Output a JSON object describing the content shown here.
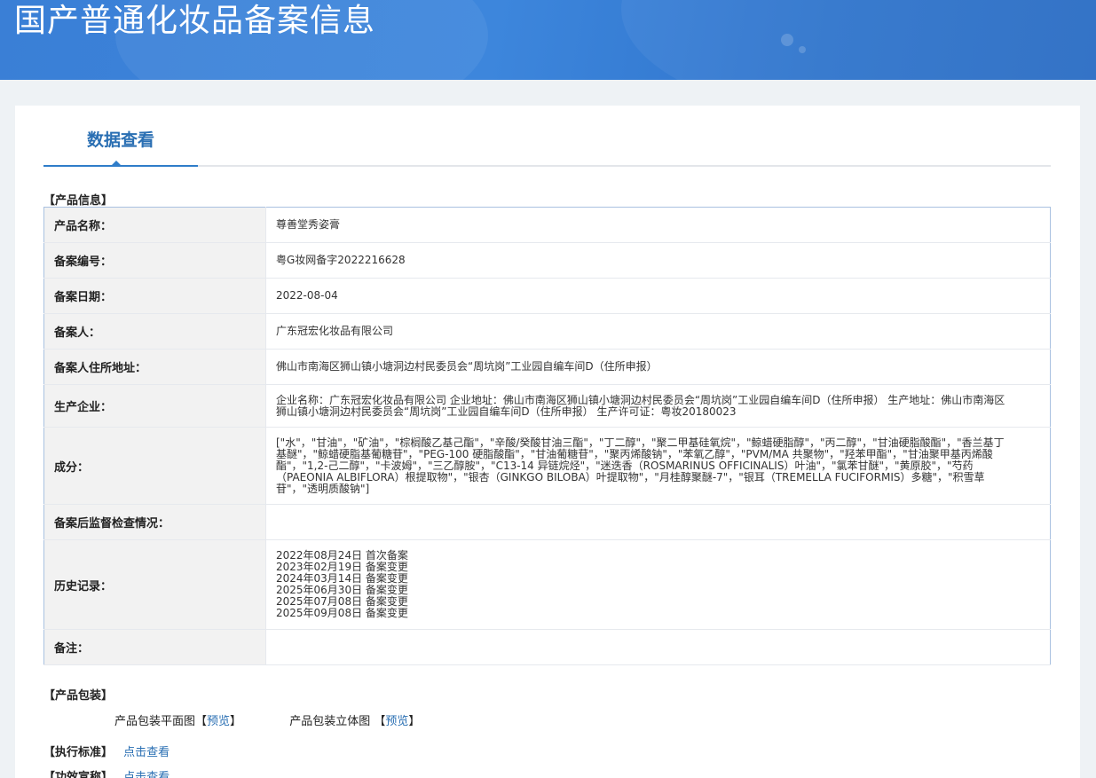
{
  "header": {
    "title": "国产普通化妆品备案信息"
  },
  "tabs": [
    {
      "label": "数据查看"
    }
  ],
  "product_info": {
    "section_title": "【产品信息】",
    "rows": [
      {
        "label": "产品名称：",
        "value": "尊善堂秀姿膏"
      },
      {
        "label": "备案编号：",
        "value": "粤G妆网备字2022216628"
      },
      {
        "label": "备案日期：",
        "value": "2022-08-04"
      },
      {
        "label": "备案人：",
        "value": "广东冠宏化妆品有限公司"
      },
      {
        "label": "备案人住所地址：",
        "value": "佛山市南海区狮山镇小塘洞边村民委员会“周坑岗”工业园自编车间D（住所申报）"
      },
      {
        "label": "生产企业：",
        "value": "企业名称：广东冠宏化妆品有限公司 企业地址：佛山市南海区狮山镇小塘洞边村民委员会“周坑岗”工业园自编车间D（住所申报） 生产地址：佛山市南海区狮山镇小塘洞边村民委员会“周坑岗”工业园自编车间D（住所申报） 生产许可证：粤妆20180023"
      },
      {
        "label": "成分：",
        "value": "[\"水\"，\"甘油\"，\"矿油\"，\"棕榈酸乙基己酯\"，\"辛酸/癸酸甘油三酯\"，\"丁二醇\"，\"聚二甲基硅氧烷\"，\"鲸蜡硬脂醇\"，\"丙二醇\"，\"甘油硬脂酸酯\"，\"香兰基丁基醚\"，\"鲸蜡硬脂基葡糖苷\"，\"PEG-100 硬脂酸酯\"，\"甘油葡糖苷\"，\"聚丙烯酸钠\"，\"苯氧乙醇\"，\"PVM/MA 共聚物\"，\"羟苯甲酯\"，\"甘油聚甲基丙烯酸酯\"，\"1,2-己二醇\"，\"卡波姆\"，\"三乙醇胺\"，\"C13-14 异链烷烃\"，\"迷迭香（ROSMARINUS OFFICINALIS）叶油\"，\"氯苯甘醚\"，\"黄原胶\"，\"芍药（PAEONIA ALBIFLORA）根提取物\"，\"银杏（GINKGO BILOBA）叶提取物\"，\"月桂醇聚醚-7\"，\"银耳（TREMELLA FUCIFORMIS）多糖\"，\"积雪草苷\"，\"透明质酸钠\"]"
      },
      {
        "label": "备案后监督检查情况：",
        "value": ""
      },
      {
        "label": "历史记录：",
        "value": ""
      },
      {
        "label": "备注：",
        "value": ""
      }
    ],
    "history": [
      "2022年08月24日 首次备案",
      "2023年02月19日 备案变更",
      "2024年03月14日 备案变更",
      "2025年06月30日 备案变更",
      "2025年07月08日 备案变更",
      "2025年09月08日 备案变更"
    ]
  },
  "packaging": {
    "section_title": "【产品包装】",
    "flat_label": "产品包装平面图",
    "flat_link": "预览",
    "solid_label": "产品包装立体图",
    "solid_link": "预览"
  },
  "standard": {
    "label": "【执行标准】",
    "link": "点击查看"
  },
  "efficacy": {
    "label": "【功效宣称】",
    "link": "点击查看"
  },
  "colors": {
    "banner": "#3a7fd6",
    "accent": "#2f7dc9",
    "link": "#2a6fb3",
    "label_bg": "#f2f2f2"
  }
}
